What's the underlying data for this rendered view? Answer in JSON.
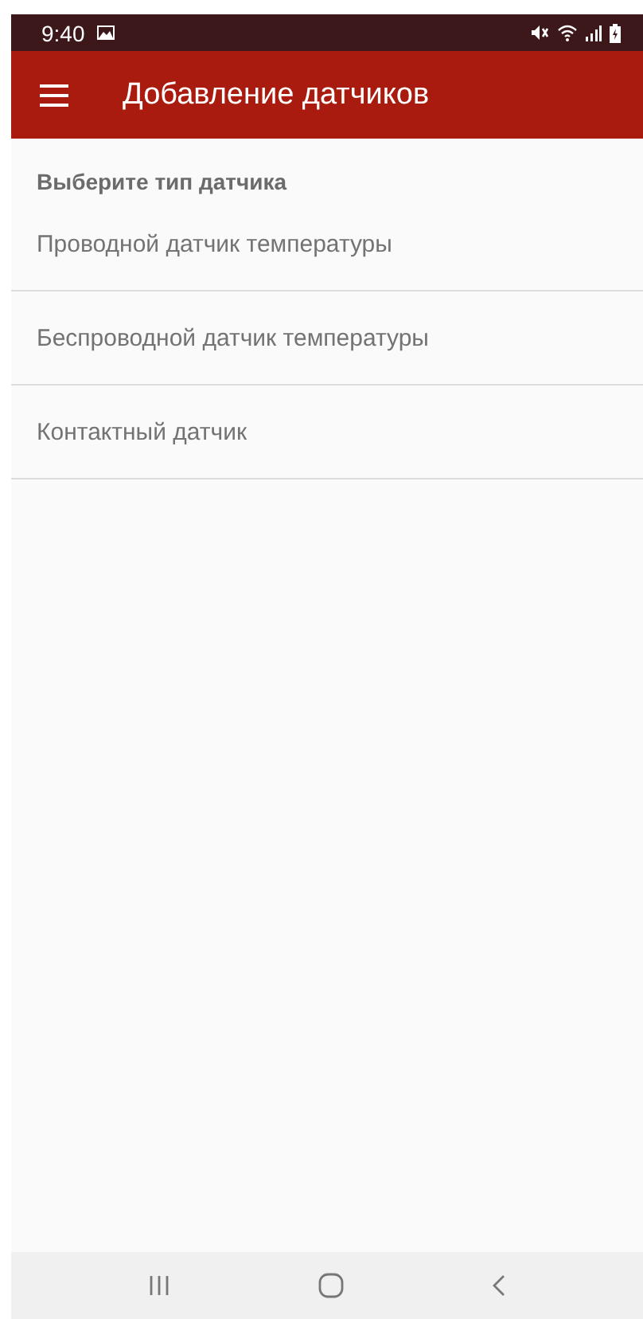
{
  "status_bar": {
    "time": "9:40"
  },
  "app_bar": {
    "title": "Добавление датчиков"
  },
  "section": {
    "title": "Выберите тип датчика"
  },
  "items": [
    {
      "label": "Проводной датчик температуры"
    },
    {
      "label": "Беспроводной датчик температуры"
    },
    {
      "label": "Контактный датчик"
    }
  ]
}
